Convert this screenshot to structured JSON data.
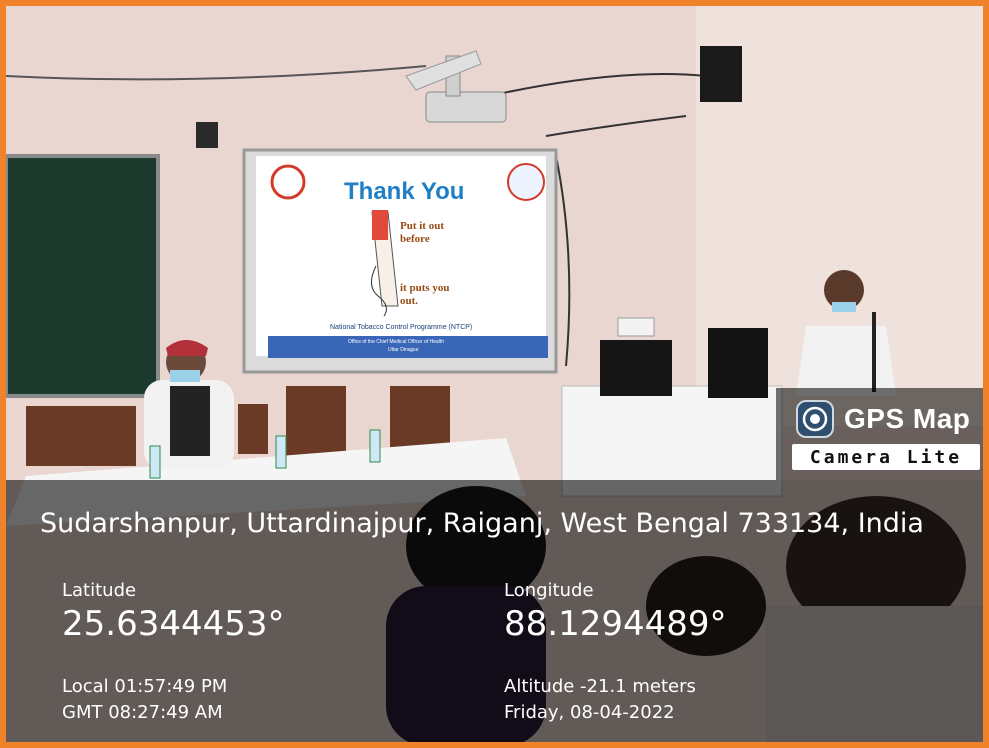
{
  "slide": {
    "title": "Thank You",
    "message_top": "Put it out before",
    "message_bottom": "it puts you out.",
    "programme": "National Tobacco Control Programme (NTCP)",
    "office_line1": "Office of the Chief Medical Officer of Health",
    "office_line2": "Uttar Dinajpur"
  },
  "branding": {
    "title": "GPS Map",
    "subtitle": "Camera Lite"
  },
  "location": {
    "address": "Sudarshanpur, Uttardinajpur, Raiganj, West Bengal 733134, India",
    "latitude_label": "Latitude",
    "latitude_value": "25.6344453°",
    "longitude_label": "Longitude",
    "longitude_value": "88.1294489°",
    "local_time": "Local 01:57:49 PM",
    "gmt_time": "GMT 08:27:49 AM",
    "altitude": "Altitude -21.1 meters",
    "date": "Friday, 08-04-2022"
  },
  "colors": {
    "border": "#f0822a",
    "slide_title": "#1e7fc6",
    "overlay": "rgba(0,0,0,0.58)"
  }
}
